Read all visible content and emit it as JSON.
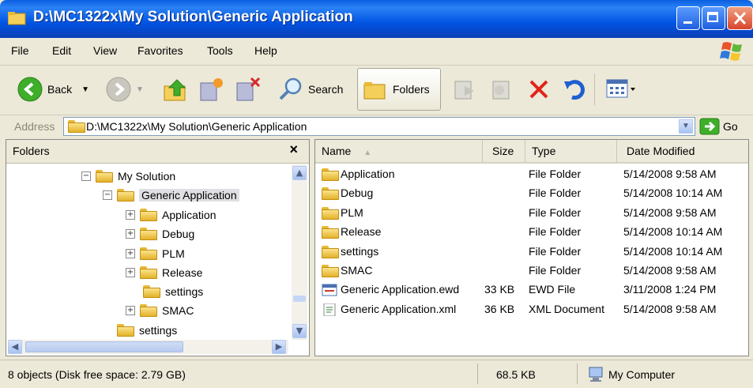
{
  "window": {
    "title": "D:\\MC1322x\\My Solution\\Generic Application"
  },
  "menu": [
    {
      "label": "File"
    },
    {
      "label": "Edit"
    },
    {
      "label": "View"
    },
    {
      "label": "Favorites"
    },
    {
      "label": "Tools"
    },
    {
      "label": "Help"
    }
  ],
  "toolbar": {
    "back_label": "Back",
    "search_label": "Search",
    "folders_label": "Folders"
  },
  "address": {
    "label": "Address",
    "value": "D:\\MC1322x\\My Solution\\Generic Application",
    "go_label": "Go"
  },
  "folders_pane": {
    "title": "Folders",
    "close": "×",
    "tree": [
      {
        "label": "My Solution",
        "expander": "−"
      },
      {
        "label": "Generic Application",
        "expander": "−"
      },
      {
        "label": "Application",
        "expander": "+"
      },
      {
        "label": "Debug",
        "expander": "+"
      },
      {
        "label": "PLM",
        "expander": "+"
      },
      {
        "label": "Release",
        "expander": "+"
      },
      {
        "label": "settings",
        "expander": ""
      },
      {
        "label": "SMAC",
        "expander": "+"
      },
      {
        "label": "settings",
        "expander": ""
      }
    ]
  },
  "file_list": {
    "columns": [
      "Name",
      "Size",
      "Type",
      "Date Modified"
    ],
    "rows": [
      {
        "name": "Application",
        "size": "",
        "type": "File Folder",
        "date": "5/14/2008 9:58 AM"
      },
      {
        "name": "Debug",
        "size": "",
        "type": "File Folder",
        "date": "5/14/2008 10:14 AM"
      },
      {
        "name": "PLM",
        "size": "",
        "type": "File Folder",
        "date": "5/14/2008 9:58 AM"
      },
      {
        "name": "Release",
        "size": "",
        "type": "File Folder",
        "date": "5/14/2008 10:14 AM"
      },
      {
        "name": "settings",
        "size": "",
        "type": "File Folder",
        "date": "5/14/2008 10:14 AM"
      },
      {
        "name": "SMAC",
        "size": "",
        "type": "File Folder",
        "date": "5/14/2008 9:58 AM"
      },
      {
        "name": "Generic Application.ewd",
        "size": "33 KB",
        "type": "EWD File",
        "date": "3/11/2008 1:24 PM"
      },
      {
        "name": "Generic Application.xml",
        "size": "36 KB",
        "type": "XML Document",
        "date": "5/14/2008 9:58 AM"
      }
    ]
  },
  "status": {
    "objects": "8 objects (Disk free space: 2.79 GB)",
    "size": "68.5 KB",
    "location": "My Computer"
  }
}
